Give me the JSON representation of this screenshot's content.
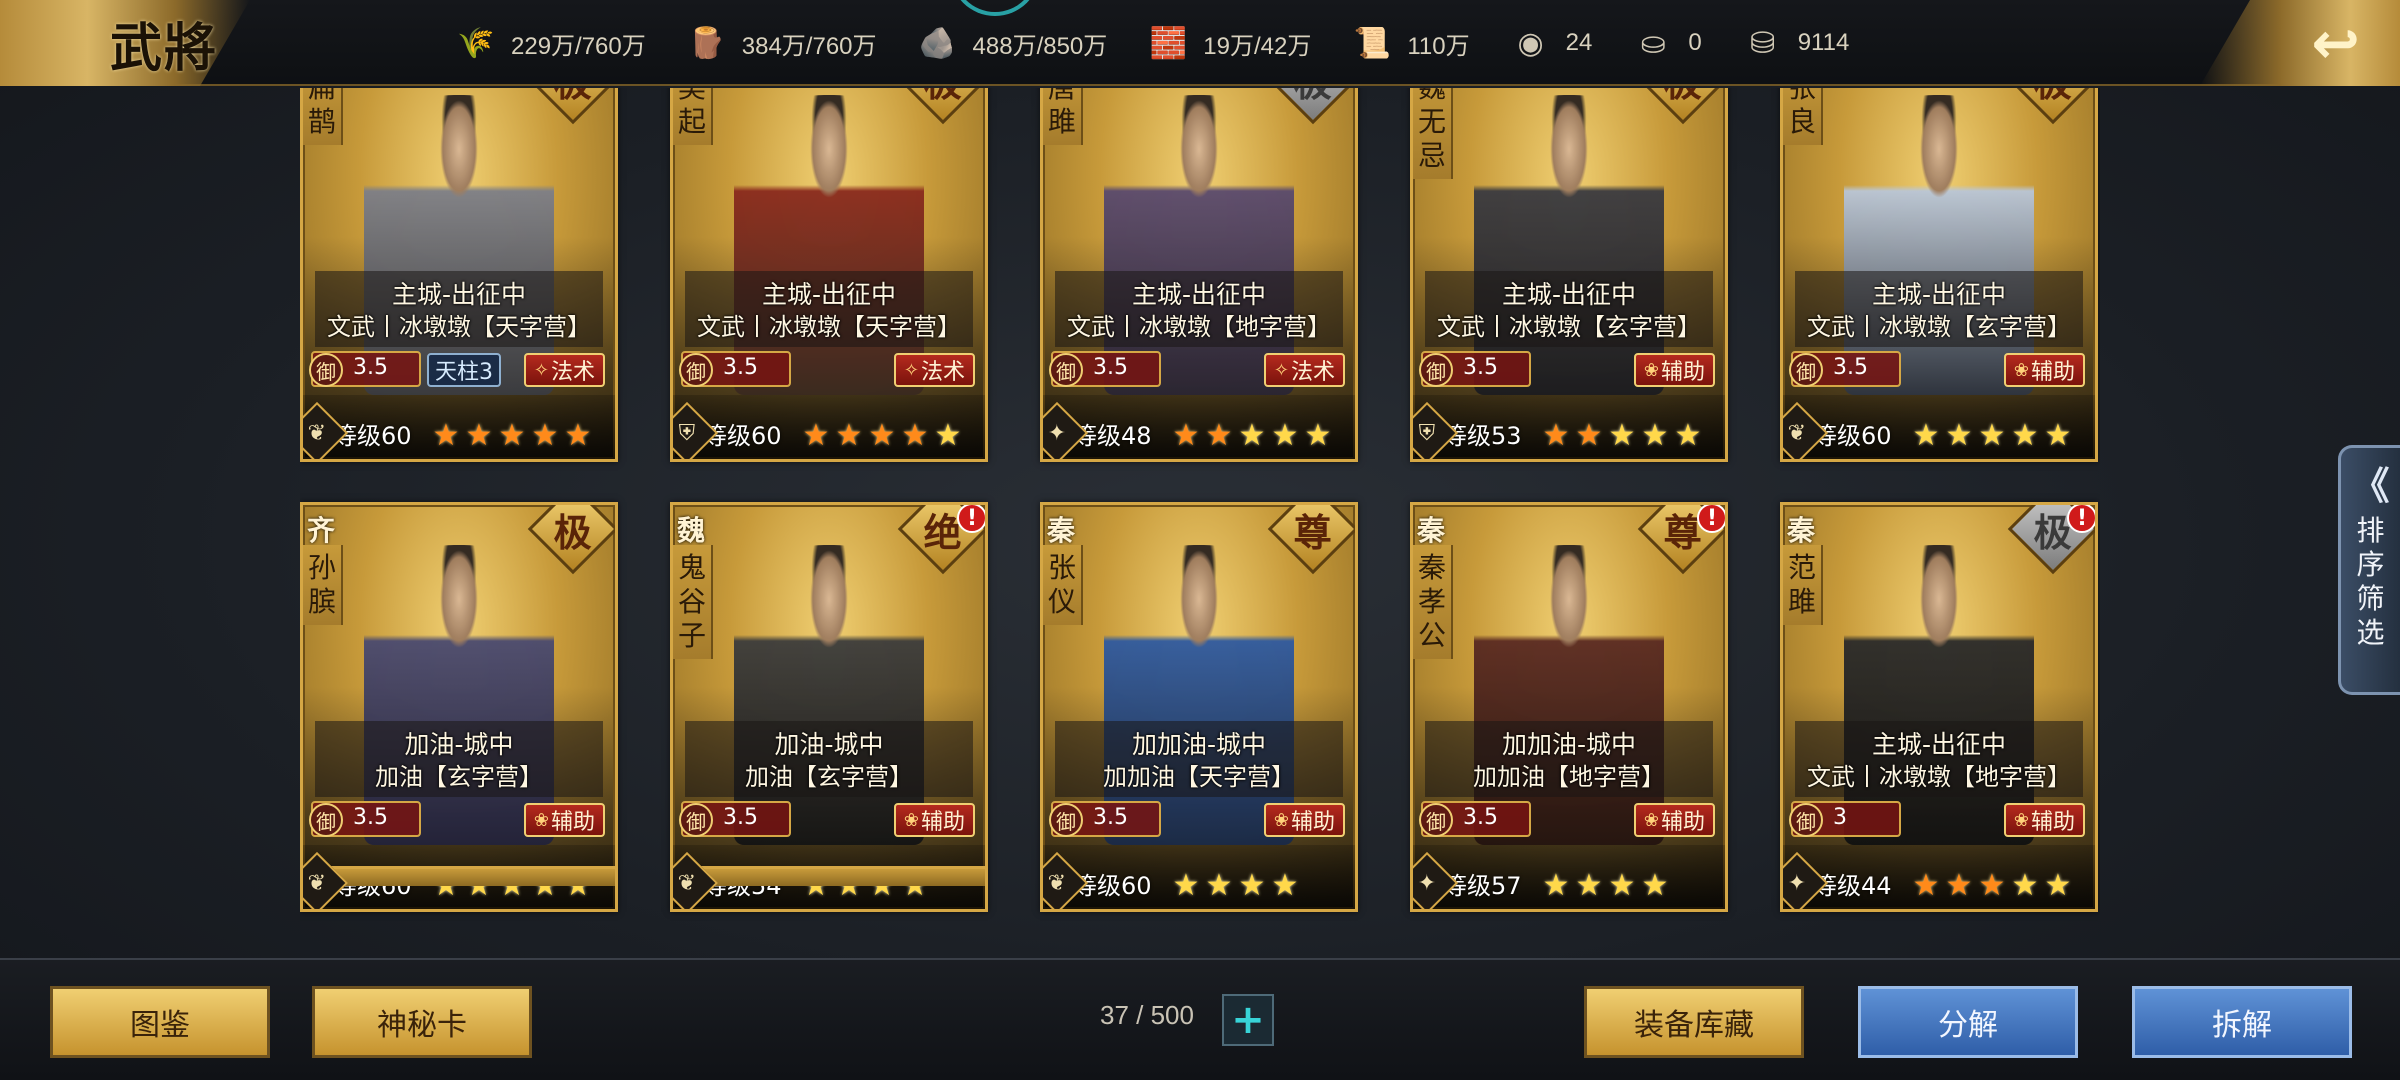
{
  "header": {
    "title": "武將",
    "resources": [
      {
        "icon": "grain-icon",
        "glyph": "🌾",
        "value": "229万/760万"
      },
      {
        "icon": "wood-icon",
        "glyph": "🪵",
        "value": "384万/760万"
      },
      {
        "icon": "stone-icon",
        "glyph": "🪨",
        "value": "488万/850万"
      },
      {
        "icon": "iron-icon",
        "glyph": "🧱",
        "value": "19万/42万"
      },
      {
        "icon": "command-icon",
        "glyph": "📜",
        "value": "110万"
      },
      {
        "icon": "copper-coin-icon",
        "glyph": "◉",
        "value": "24"
      },
      {
        "icon": "gold-ingot-icon",
        "glyph": "⛀",
        "value": "0"
      },
      {
        "icon": "silver-ingot-icon",
        "glyph": "⛁",
        "value": "9114"
      }
    ],
    "back_glyph": "↩"
  },
  "cards": [
    {
      "name": [
        "扁",
        "鹊"
      ],
      "faction": "",
      "rank": "极",
      "rank_gray": false,
      "alert": false,
      "status1": "主城-出征中",
      "status2": "文武丨冰墩墩【天字营】",
      "def_label": "御",
      "def": "3.5",
      "tag": "法术",
      "tag_icon": "✧",
      "tag2": "天柱3",
      "level": "等级60",
      "stars": [
        "orange",
        "orange",
        "orange",
        "orange",
        "orange"
      ],
      "type_icon": "❦",
      "robe": "#7d7f88",
      "robe2": "#3a3b40"
    },
    {
      "name": [
        "吴",
        "起"
      ],
      "faction": "",
      "rank": "极",
      "rank_gray": false,
      "alert": false,
      "status1": "主城-出征中",
      "status2": "文武丨冰墩墩【天字营】",
      "def_label": "御",
      "def": "3.5",
      "tag": "法术",
      "tag_icon": "✧",
      "tag2": "",
      "level": "等级60",
      "stars": [
        "orange",
        "orange",
        "orange",
        "orange",
        "gold"
      ],
      "type_icon": "⛨",
      "robe": "#8a2a1e",
      "robe2": "#3a2a20"
    },
    {
      "name": [
        "唐",
        "雎"
      ],
      "faction": "",
      "rank": "极",
      "rank_gray": true,
      "alert": false,
      "status1": "主城-出征中",
      "status2": "文武丨冰墩墩【地字营】",
      "def_label": "御",
      "def": "3.5",
      "tag": "法术",
      "tag_icon": "✧",
      "tag2": "",
      "level": "等级48",
      "stars": [
        "orange",
        "orange",
        "gold",
        "gold",
        "gold"
      ],
      "type_icon": "✦",
      "robe": "#5a4a6e",
      "robe2": "#2a2533"
    },
    {
      "name": [
        "魏",
        "无",
        "忌"
      ],
      "faction": "",
      "rank": "极",
      "rank_gray": false,
      "alert": false,
      "status1": "主城-出征中",
      "status2": "文武丨冰墩墩【玄字营】",
      "def_label": "御",
      "def": "3.5",
      "tag": "辅助",
      "tag_icon": "❀",
      "tag2": "",
      "level": "等级53",
      "stars": [
        "orange",
        "orange",
        "gold",
        "gold",
        "gold"
      ],
      "type_icon": "⛨",
      "robe": "#3a3a40",
      "robe2": "#1c1c20"
    },
    {
      "name": [
        "张",
        "良"
      ],
      "faction": "",
      "rank": "极",
      "rank_gray": false,
      "alert": false,
      "status1": "主城-出征中",
      "status2": "文武丨冰墩墩【玄字营】",
      "def_label": "御",
      "def": "3.5",
      "tag": "辅助",
      "tag_icon": "❀",
      "tag2": "",
      "level": "等级60",
      "stars": [
        "gold",
        "gold",
        "gold",
        "gold",
        "gold"
      ],
      "type_icon": "❦",
      "robe": "#b9c6d8",
      "robe2": "#2e3440"
    },
    {
      "name": [
        "孙",
        "膑"
      ],
      "faction": "齐",
      "rank": "极",
      "rank_gray": false,
      "alert": false,
      "status1": "加油-城中",
      "status2": "加油【玄字营】",
      "def_label": "御",
      "def": "3.5",
      "tag": "辅助",
      "tag_icon": "❀",
      "tag2": "",
      "level": "等级60",
      "stars": [
        "gold",
        "gold",
        "gold",
        "gold",
        "gold"
      ],
      "type_icon": "❦",
      "robe": "#4a4a70",
      "robe2": "#22223a"
    },
    {
      "name": [
        "鬼",
        "谷",
        "子"
      ],
      "faction": "魏",
      "rank": "绝",
      "rank_gray": false,
      "alert": true,
      "status1": "加油-城中",
      "status2": "加油【玄字营】",
      "def_label": "御",
      "def": "3.5",
      "tag": "辅助",
      "tag_icon": "❀",
      "tag2": "",
      "level": "等级54",
      "stars": [
        "gold",
        "gold",
        "gold",
        "gold"
      ],
      "type_icon": "❦",
      "robe": "#3c3c3c",
      "robe2": "#141414"
    },
    {
      "name": [
        "张",
        "仪"
      ],
      "faction": "秦",
      "rank": "尊",
      "rank_gray": false,
      "alert": false,
      "status1": "加加油-城中",
      "status2": "加加油【天字营】",
      "def_label": "御",
      "def": "3.5",
      "tag": "辅助",
      "tag_icon": "❀",
      "tag2": "",
      "level": "等级60",
      "stars": [
        "gold",
        "gold",
        "gold",
        "gold"
      ],
      "type_icon": "❦",
      "robe": "#2f5aa0",
      "robe2": "#1a2a48"
    },
    {
      "name": [
        "秦",
        "孝",
        "公"
      ],
      "faction": "秦",
      "rank": "尊",
      "rank_gray": false,
      "alert": true,
      "status1": "加加油-城中",
      "status2": "加加油【地字营】",
      "def_label": "御",
      "def": "3.5",
      "tag": "辅助",
      "tag_icon": "❀",
      "tag2": "",
      "level": "等级57",
      "stars": [
        "gold",
        "gold",
        "gold",
        "gold"
      ],
      "type_icon": "✦",
      "robe": "#5a2a22",
      "robe2": "#241410"
    },
    {
      "name": [
        "范",
        "雎"
      ],
      "faction": "秦",
      "rank": "极",
      "rank_gray": true,
      "alert": true,
      "status1": "主城-出征中",
      "status2": "文武丨冰墩墩【地字营】",
      "def_label": "御",
      "def": "3",
      "tag": "辅助",
      "tag_icon": "❀",
      "tag2": "",
      "level": "等级44",
      "stars": [
        "orange",
        "orange",
        "orange",
        "gold",
        "gold"
      ],
      "type_icon": "✦",
      "robe": "#2a2a2a",
      "robe2": "#111111"
    }
  ],
  "sort_tab": {
    "chevron": "《",
    "label": "排序筛选"
  },
  "footer": {
    "atlas": "图鉴",
    "mystery_card": "神秘卡",
    "count": "37 / 500",
    "plus": "+",
    "equipment_store": "装备库藏",
    "decompose": "分解",
    "dismantle": "拆解"
  }
}
